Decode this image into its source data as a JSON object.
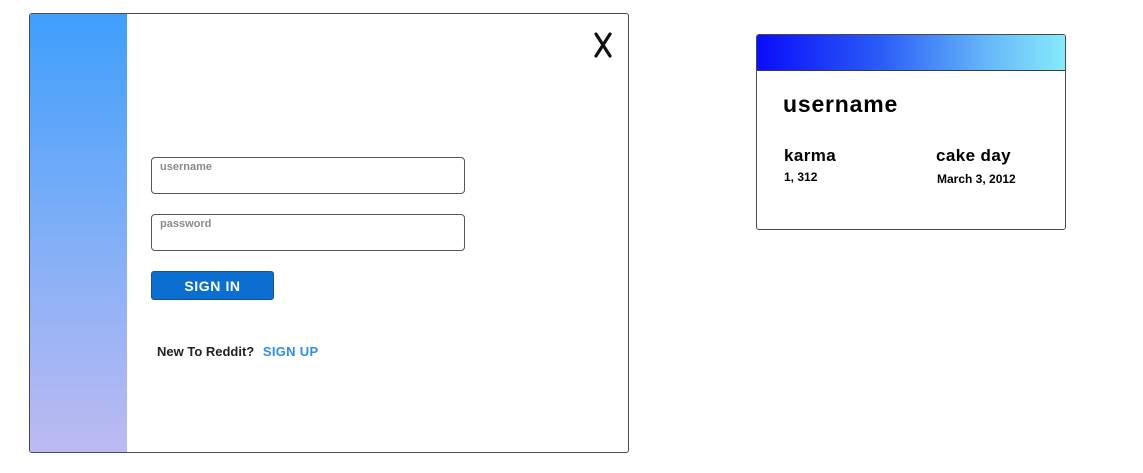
{
  "login_modal": {
    "close_label": "X",
    "username_field": {
      "label": "username",
      "value": ""
    },
    "password_field": {
      "label": "password",
      "value": ""
    },
    "signin_label": "SIGN IN",
    "signup_prompt": "New To Reddit?",
    "signup_link": "SIGN UP",
    "colors": {
      "sidebar_top": "#3f9ffb",
      "sidebar_bottom": "#bdbaf2",
      "button": "#0a6fd0",
      "link": "#2d8fe8"
    }
  },
  "profile_card": {
    "username": "username",
    "karma_label": "karma",
    "karma_value": "1, 312",
    "cake_day_label": "cake day",
    "cake_day_value": "March 3, 2012",
    "colors": {
      "banner_start": "#0a0dfa",
      "banner_end": "#86eafb"
    }
  }
}
